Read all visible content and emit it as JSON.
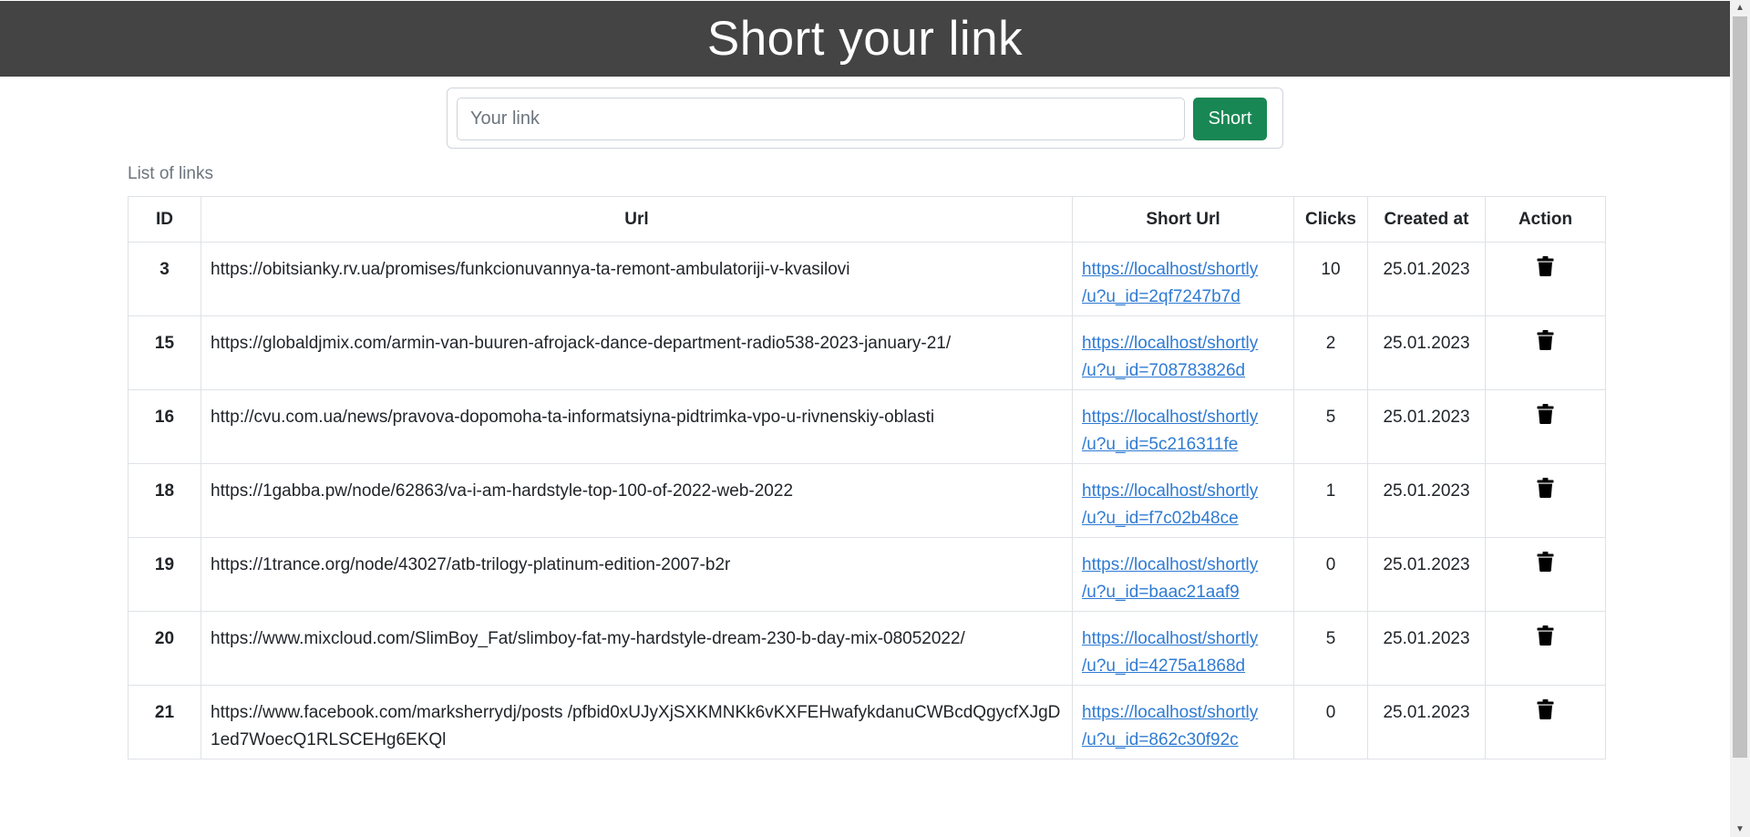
{
  "header": {
    "title": "Short your link"
  },
  "form": {
    "placeholder": "Your link",
    "button_label": "Short"
  },
  "list": {
    "caption": "List of links",
    "columns": [
      "ID",
      "Url",
      "Short Url",
      "Clicks",
      "Created at",
      "Action"
    ],
    "rows": [
      {
        "id": "3",
        "url": "https://obitsianky.rv.ua/promises/funkcionuvannya-ta-remont-ambulatoriji-v-kvasilovi",
        "short_line1": "https://localhost/shortly",
        "short_line2": "/u?u_id=2qf7247b7d",
        "clicks": "10",
        "created": "25.01.2023"
      },
      {
        "id": "15",
        "url": "https://globaldjmix.com/armin-van-buuren-afrojack-dance-department-radio538-2023-january-21/",
        "short_line1": "https://localhost/shortly",
        "short_line2": "/u?u_id=708783826d",
        "clicks": "2",
        "created": "25.01.2023"
      },
      {
        "id": "16",
        "url": "http://cvu.com.ua/news/pravova-dopomoha-ta-informatsiyna-pidtrimka-vpo-u-rivnenskiy-oblasti",
        "short_line1": "https://localhost/shortly",
        "short_line2": "/u?u_id=5c216311fe",
        "clicks": "5",
        "created": "25.01.2023"
      },
      {
        "id": "18",
        "url": "https://1gabba.pw/node/62863/va-i-am-hardstyle-top-100-of-2022-web-2022",
        "short_line1": "https://localhost/shortly",
        "short_line2": "/u?u_id=f7c02b48ce",
        "clicks": "1",
        "created": "25.01.2023"
      },
      {
        "id": "19",
        "url": "https://1trance.org/node/43027/atb-trilogy-platinum-edition-2007-b2r",
        "short_line1": "https://localhost/shortly",
        "short_line2": "/u?u_id=baac21aaf9",
        "clicks": "0",
        "created": "25.01.2023"
      },
      {
        "id": "20",
        "url": "https://www.mixcloud.com/SlimBoy_Fat/slimboy-fat-my-hardstyle-dream-230-b-day-mix-08052022/",
        "short_line1": "https://localhost/shortly",
        "short_line2": "/u?u_id=4275a1868d",
        "clicks": "5",
        "created": "25.01.2023"
      },
      {
        "id": "21",
        "url": "https://www.facebook.com/marksherrydj/posts /pfbid0xUJyXjSXKMNKk6vKXFEHwafykdanuCWBcdQgycfXJgD1ed7WoecQ1RLSCEHg6EKQl",
        "short_line1": "https://localhost/shortly",
        "short_line2": "/u?u_id=862c30f92c",
        "clicks": "0",
        "created": "25.01.2023"
      }
    ]
  },
  "icons": {
    "delete": "trash-icon"
  },
  "colors": {
    "header_bg": "#444444",
    "button_bg": "#198754",
    "link": "#2f7bd3"
  }
}
